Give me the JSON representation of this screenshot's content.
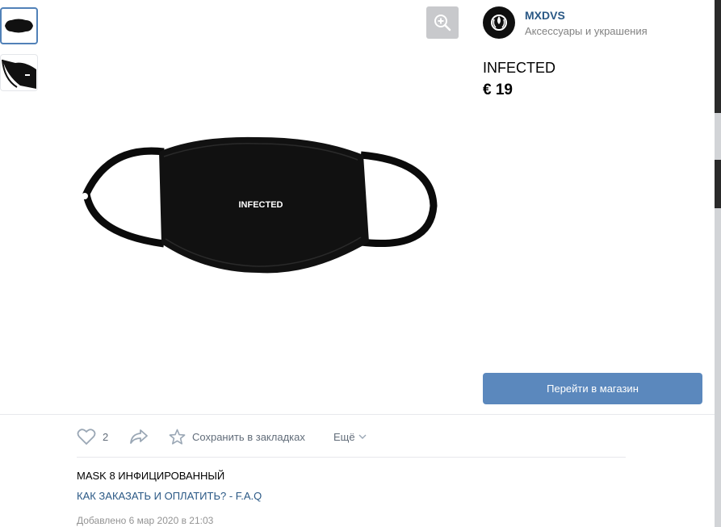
{
  "thumbnails": [
    {
      "icon": "mask-front-thumbnail",
      "selected": true
    },
    {
      "icon": "mask-side-thumbnail",
      "selected": false
    }
  ],
  "image": {
    "print_text": "INFECTED"
  },
  "shop": {
    "name": "MXDVS",
    "category": "Аксессуары и украшения"
  },
  "product": {
    "title": "INFECTED",
    "price": "€ 19"
  },
  "buttons": {
    "go_to_shop": "Перейти в магазин"
  },
  "actions": {
    "likes_count": "2",
    "save_label": "Сохранить в закладках",
    "more_label": "Ещё"
  },
  "description": {
    "text": "MASK 8 ИНФИЦИРОВАННЫЙ",
    "link": "КАК ЗАКАЗАТЬ И ОПЛАТИТЬ? - F.A.Q",
    "added": "Добавлено 6 мар 2020 в 21:03"
  },
  "colors": {
    "accent": "#5b88bd",
    "link": "#2a5885",
    "muted": "#828282"
  }
}
